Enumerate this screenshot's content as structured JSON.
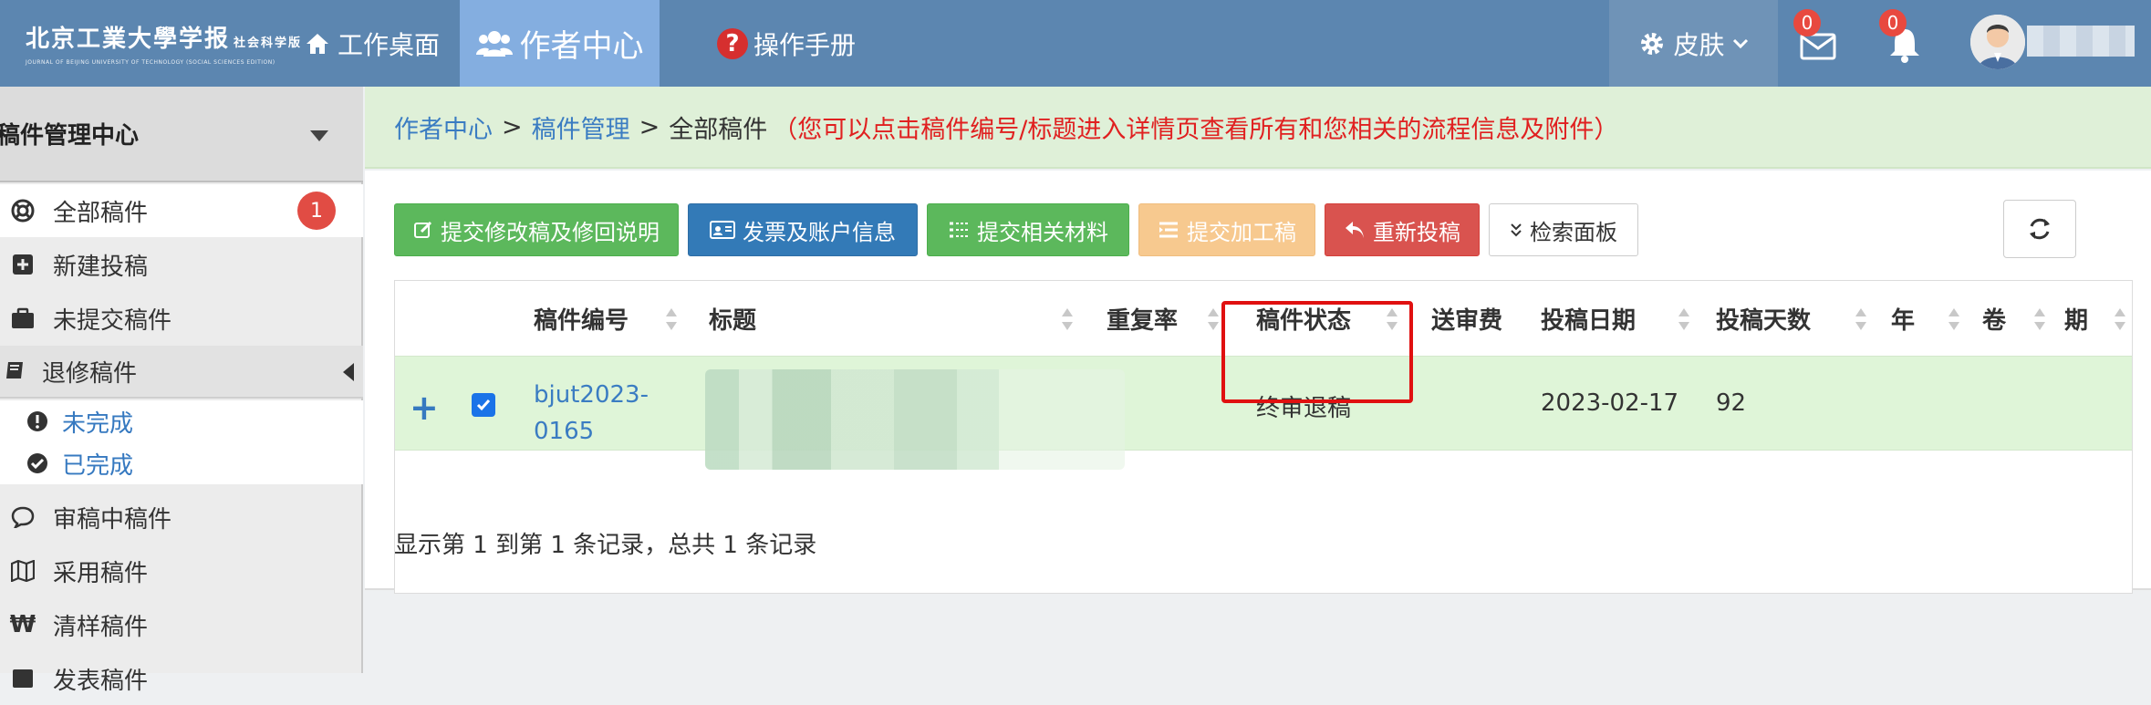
{
  "header": {
    "logo_main": "北京工業大學学报",
    "logo_small": "社会科学版",
    "logo_en": "JOURNAL OF BEIJING UNIVERSITY OF TECHNOLOGY (SOCIAL SCIENCES EDITION)",
    "nav": [
      {
        "label": "工作桌面",
        "icon": "home-icon"
      },
      {
        "label": "作者中心",
        "icon": "users-icon",
        "active": true
      },
      {
        "label": "操作手册",
        "icon": "help-icon"
      }
    ],
    "skin_label": "皮肤",
    "mail_badge": "0",
    "bell_badge": "0"
  },
  "sidebar": {
    "title": "稿件管理中心",
    "items": [
      {
        "label": "全部稿件",
        "icon": "lifebuoy-icon",
        "count": "1"
      },
      {
        "label": "新建投稿",
        "icon": "plus-square-icon"
      },
      {
        "label": "未提交稿件",
        "icon": "briefcase-icon"
      },
      {
        "label": "退修稿件",
        "icon": "book-icon"
      },
      {
        "label": "未完成",
        "icon": "exclamation-circle-icon"
      },
      {
        "label": "已完成",
        "icon": "check-circle-icon"
      },
      {
        "label": "审稿中稿件",
        "icon": "comment-icon"
      },
      {
        "label": "采用稿件",
        "icon": "map-icon"
      },
      {
        "label": "清样稿件",
        "icon": "won-icon"
      },
      {
        "label": "发表稿件",
        "icon": "archive-icon"
      }
    ]
  },
  "breadcrumb": {
    "root": "作者中心",
    "section": "稿件管理",
    "current": "全部稿件",
    "note": "（您可以点击稿件编号/标题进入详情页查看所有和您相关的流程信息及附件）"
  },
  "toolbar": {
    "submit_revision": "提交修改稿及修回说明",
    "invoice": "发票及账户信息",
    "submit_materials": "提交相关材料",
    "submit_processed": "提交加工稿",
    "resubmit": "重新投稿",
    "search_panel": "检索面板"
  },
  "table": {
    "columns": [
      "稿件编号",
      "标题",
      "重复率",
      "稿件状态",
      "送审费",
      "投稿日期",
      "投稿天数",
      "年",
      "卷",
      "期"
    ],
    "rows": [
      {
        "id_line1": "bjut2023-",
        "id_line2": "0165",
        "status": "终审退稿",
        "date": "2023-02-17",
        "days": "92"
      }
    ],
    "footer": "显示第 1 到第 1 条记录，总共 1 条记录"
  },
  "colors": {
    "topbar": "#5c86b0",
    "nav_active": "#84aee0",
    "breadcrumb_bg": "#dff0d8",
    "row_bg": "#dff5d8",
    "highlight": "#e01010"
  }
}
